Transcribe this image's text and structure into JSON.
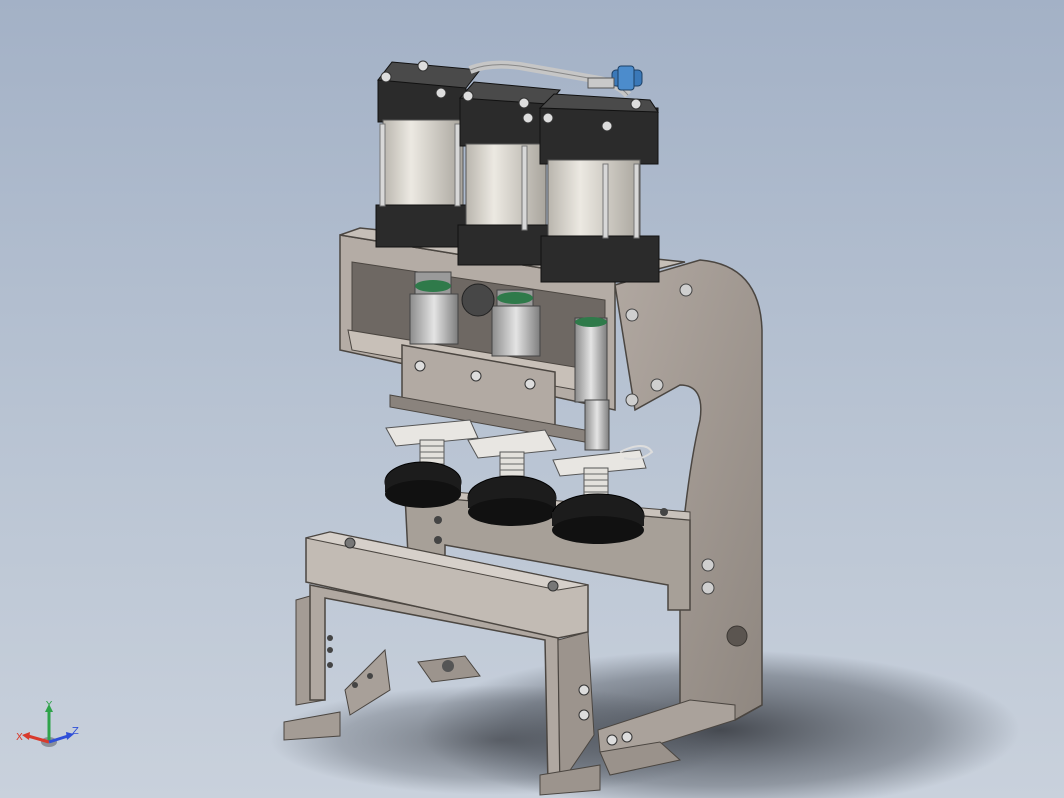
{
  "viewport": {
    "background_top": "#a3b1c6",
    "background_bottom": "#c9d1dc"
  },
  "model": {
    "name": "pneumatic-triple-press-assembly",
    "cylinder_count": 3,
    "colors": {
      "frame": "#a39a93",
      "frame_dark": "#7c746e",
      "cylinder_body": "#d6d2c9",
      "cylinder_cap": "#2b2b2b",
      "pad": "#1c1c1c",
      "fitting": "#3a78b8"
    }
  },
  "triad": {
    "x_label": "X",
    "y_label": "Y",
    "z_label": "Z",
    "x_color": "#d83a2c",
    "y_color": "#2fa34a",
    "z_color": "#2f4fd8"
  }
}
